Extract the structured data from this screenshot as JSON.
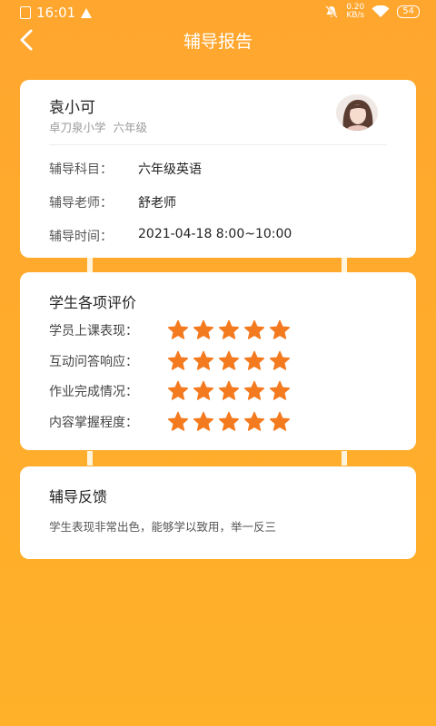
{
  "status": {
    "time": "16:01",
    "speed": "0.20",
    "speed_unit": "KB/s",
    "battery": "54"
  },
  "header": {
    "title": "辅导报告"
  },
  "student": {
    "name": "袁小可",
    "school": "卓刀泉小学",
    "grade": "六年级",
    "subject_label": "辅导科目：",
    "subject": "六年级英语",
    "teacher_label": "辅导老师：",
    "teacher": "舒老师",
    "time_label": "辅导时间：",
    "time": "2021-04-18 8:00~10:00"
  },
  "evaluation": {
    "title": "学生各项评价",
    "items": [
      {
        "label": "学员上课表现：",
        "stars": 5
      },
      {
        "label": "互动问答响应：",
        "stars": 5
      },
      {
        "label": "作业完成情况：",
        "stars": 5
      },
      {
        "label": "内容掌握程度：",
        "stars": 5
      }
    ],
    "star_color": "#f47a1f"
  },
  "feedback": {
    "title": "辅导反馈",
    "text": "学生表现非常出色，能够学以致用，举一反三"
  }
}
